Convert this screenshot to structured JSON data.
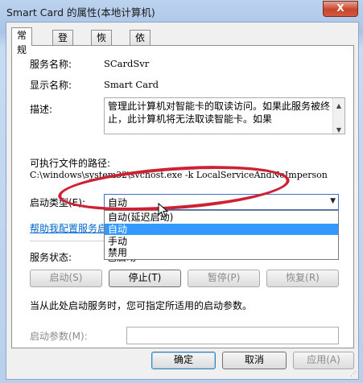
{
  "window": {
    "title": "Smart Card 的属性(本地计算机)",
    "close_glyph": "X"
  },
  "tabs": [
    {
      "label": "常规"
    },
    {
      "label": "登录"
    },
    {
      "label": "恢复"
    },
    {
      "label": "依存关系"
    }
  ],
  "general": {
    "service_name_label": "服务名称:",
    "service_name_value": "SCardSvr",
    "display_name_label": "显示名称:",
    "display_name_value": "Smart Card",
    "description_label": "描述:",
    "description_value": "管理此计算机对智能卡的取读访问。如果此服务被终止，此计算机将无法取读智能卡。如果",
    "path_label": "可执行文件的路径:",
    "path_value": "C:\\windows\\system32\\svchost.exe -k LocalServiceAndNoImperson",
    "startup_type_label": "启动类型(E):",
    "startup_type_value": "自动",
    "startup_options": [
      "自动(延迟启动)",
      "自动",
      "手动",
      "禁用"
    ],
    "help_link": "帮助我配置服务启动",
    "status_label": "服务状态:",
    "status_value": "已启动",
    "buttons": {
      "start": "启动(S)",
      "stop": "停止(T)",
      "pause": "暂停(P)",
      "resume": "恢复(R)"
    },
    "hint": "当从此处启动服务时，您可指定所适用的启动参数。",
    "start_params_label": "启动参数(M):",
    "start_params_value": ""
  },
  "footer": {
    "ok": "确定",
    "cancel": "取消",
    "apply": "应用(A)"
  },
  "colors": {
    "highlight": "#3399ff",
    "annotation": "#cc2233",
    "link": "#0066cc"
  }
}
